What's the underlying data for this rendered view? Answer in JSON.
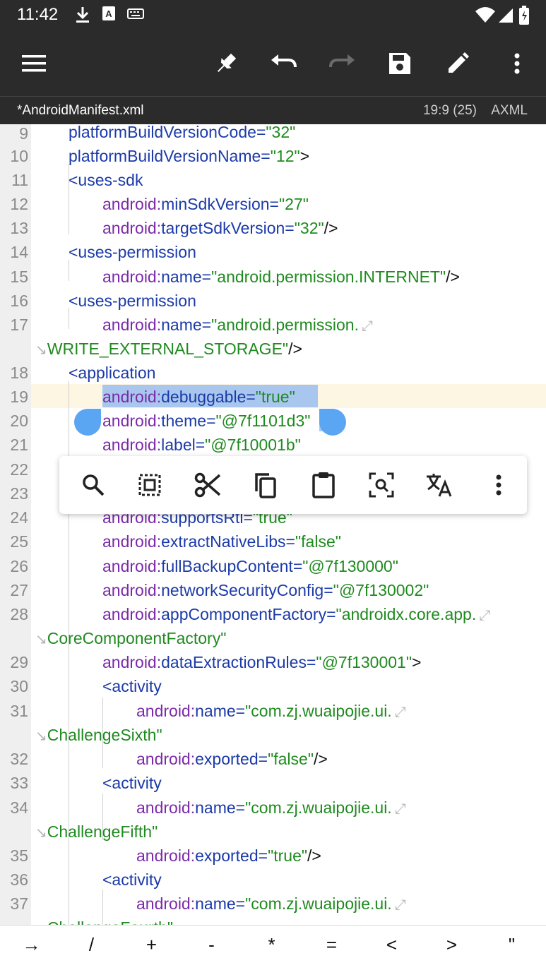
{
  "status_bar": {
    "time": "11:42",
    "icons": [
      "download-icon",
      "a-icon",
      "keyboard-icon",
      "wifi-icon",
      "signal-icon",
      "battery-icon"
    ]
  },
  "toolbar": {
    "buttons": [
      "menu-icon",
      "pin-icon",
      "undo-icon",
      "redo-icon",
      "save-icon",
      "edit-icon",
      "more-icon"
    ]
  },
  "file_bar": {
    "filename": "*AndroidManifest.xml",
    "position": "19:9 (25)",
    "language": "AXML"
  },
  "editor": {
    "line_numbers": [
      "9",
      "10",
      "11",
      "12",
      "13",
      "14",
      "15",
      "16",
      "17",
      "",
      "18",
      "19",
      "20",
      "21",
      "22",
      "23",
      "24",
      "25",
      "26",
      "27",
      "28",
      "",
      "29",
      "30",
      "31",
      "",
      "32",
      "33",
      "34",
      "",
      "35",
      "36",
      "37"
    ],
    "lines": {
      "l9": {
        "attr": "platformBuildVersionCode",
        "eq": "=",
        "val": "\"32\""
      },
      "l10": {
        "attr": "platformBuildVersionName",
        "eq": "=",
        "val": "\"12\"",
        "end": ">"
      },
      "l11": {
        "tag": "<uses-sdk"
      },
      "l12": {
        "ns": "android",
        "colon": ":",
        "attr": "minSdkVersion",
        "eq": "=",
        "val": "\"27\""
      },
      "l13": {
        "ns": "android",
        "colon": ":",
        "attr": "targetSdkVersion",
        "eq": "=",
        "val": "\"32\"",
        "end": "/>"
      },
      "l14": {
        "tag": "<uses-permission"
      },
      "l15": {
        "ns": "android",
        "colon": ":",
        "attr": "name",
        "eq": "=",
        "val": "\"android.permission.INTERNET\"",
        "end": "/>"
      },
      "l16": {
        "tag": "<uses-permission"
      },
      "l17": {
        "ns": "android",
        "colon": ":",
        "attr": "name",
        "eq": "=",
        "val": "\"android.permission."
      },
      "l17w": {
        "val": "WRITE_EXTERNAL_STORAGE\"",
        "end": "/>"
      },
      "l18": {
        "tag": "<application"
      },
      "l19": {
        "ns": "android",
        "colon": ":",
        "attr": "debuggable",
        "eq": "=",
        "val": "\"true\""
      },
      "l20": {
        "ns": "android",
        "colon": ":",
        "attr": "theme",
        "eq": "=",
        "val": "\"@7f1101d3\""
      },
      "l21": {
        "ns": "android",
        "colon": ":",
        "attr": "label",
        "eq": "=",
        "val": "\"@7f10001b\""
      },
      "l24": {
        "ns": "android",
        "colon": ":",
        "attr": "supportsRtl",
        "eq": "=",
        "val": "\"true\""
      },
      "l25": {
        "ns": "android",
        "colon": ":",
        "attr": "extractNativeLibs",
        "eq": "=",
        "val": "\"false\""
      },
      "l26": {
        "ns": "android",
        "colon": ":",
        "attr": "fullBackupContent",
        "eq": "=",
        "val": "\"@7f130000\""
      },
      "l27": {
        "ns": "android",
        "colon": ":",
        "attr": "networkSecurityConfig",
        "eq": "=",
        "val": "\"@7f130002\""
      },
      "l28": {
        "ns": "android",
        "colon": ":",
        "attr": "appComponentFactory",
        "eq": "=",
        "val": "\"androidx.core.app."
      },
      "l28w": {
        "val": "CoreComponentFactory\""
      },
      "l29": {
        "ns": "android",
        "colon": ":",
        "attr": "dataExtractionRules",
        "eq": "=",
        "val": "\"@7f130001\"",
        "end": ">"
      },
      "l30": {
        "tag": "<activity"
      },
      "l31": {
        "ns": "android",
        "colon": ":",
        "attr": "name",
        "eq": "=",
        "val": "\"com.zj.wuaipojie.ui."
      },
      "l31w": {
        "val": "ChallengeSixth\""
      },
      "l32": {
        "ns": "android",
        "colon": ":",
        "attr": "exported",
        "eq": "=",
        "val": "\"false\"",
        "end": "/>"
      },
      "l33": {
        "tag": "<activity"
      },
      "l34": {
        "ns": "android",
        "colon": ":",
        "attr": "name",
        "eq": "=",
        "val": "\"com.zj.wuaipojie.ui."
      },
      "l34w": {
        "val": "ChallengeFifth\""
      },
      "l35": {
        "ns": "android",
        "colon": ":",
        "attr": "exported",
        "eq": "=",
        "val": "\"true\"",
        "end": "/>"
      },
      "l36": {
        "tag": "<activity"
      },
      "l37": {
        "ns": "android",
        "colon": ":",
        "attr": "name",
        "eq": "=",
        "val": "\"com.zj.wuaipojie.ui."
      },
      "l37w": {
        "val": "ChallengeFourth\""
      }
    },
    "wrap_glyph": "⤢",
    "wrap_cont_glyph": "↘"
  },
  "text_actions": {
    "buttons": [
      "search-icon",
      "select-all-icon",
      "cut-icon",
      "copy-icon",
      "paste-icon",
      "lens-icon",
      "translate-icon",
      "more-icon"
    ]
  },
  "symbol_bar": {
    "symbols": [
      "→",
      "/",
      "+",
      "-",
      "*",
      "=",
      "<",
      ">",
      "\""
    ]
  },
  "colors": {
    "chrome": "#2b2b2b",
    "tag": "#1b3aa8",
    "attr": "#7b2aa8",
    "value": "#1f8a1f",
    "selection": "#a9c7ee",
    "current_line": "#fdf6e3"
  }
}
